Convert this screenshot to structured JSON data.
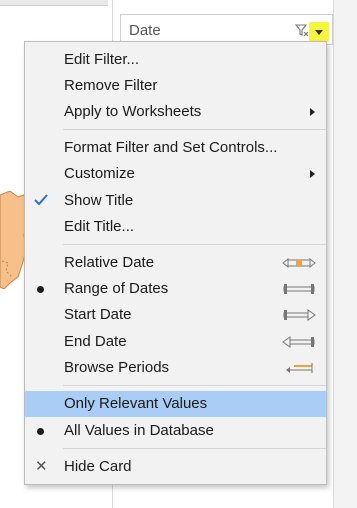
{
  "filter_card": {
    "title": "Date"
  },
  "menu": {
    "items": [
      {
        "label": "Edit Filter..."
      },
      {
        "label": "Remove Filter"
      },
      {
        "label": "Apply to Worksheets"
      },
      {
        "label": "Format Filter and Set Controls..."
      },
      {
        "label": "Customize"
      },
      {
        "label": "Show Title"
      },
      {
        "label": "Edit Title..."
      },
      {
        "label": "Relative Date"
      },
      {
        "label": "Range of Dates"
      },
      {
        "label": "Start Date"
      },
      {
        "label": "End Date"
      },
      {
        "label": "Browse Periods"
      },
      {
        "label": "Only Relevant Values"
      },
      {
        "label": "All Values in Database"
      },
      {
        "label": "Hide Card"
      }
    ]
  },
  "colors": {
    "highlight": "#a9cdf4",
    "dropdown_button": "#f6f63c",
    "check": "#2b6fd6",
    "map_fill": "#f7c08a"
  }
}
